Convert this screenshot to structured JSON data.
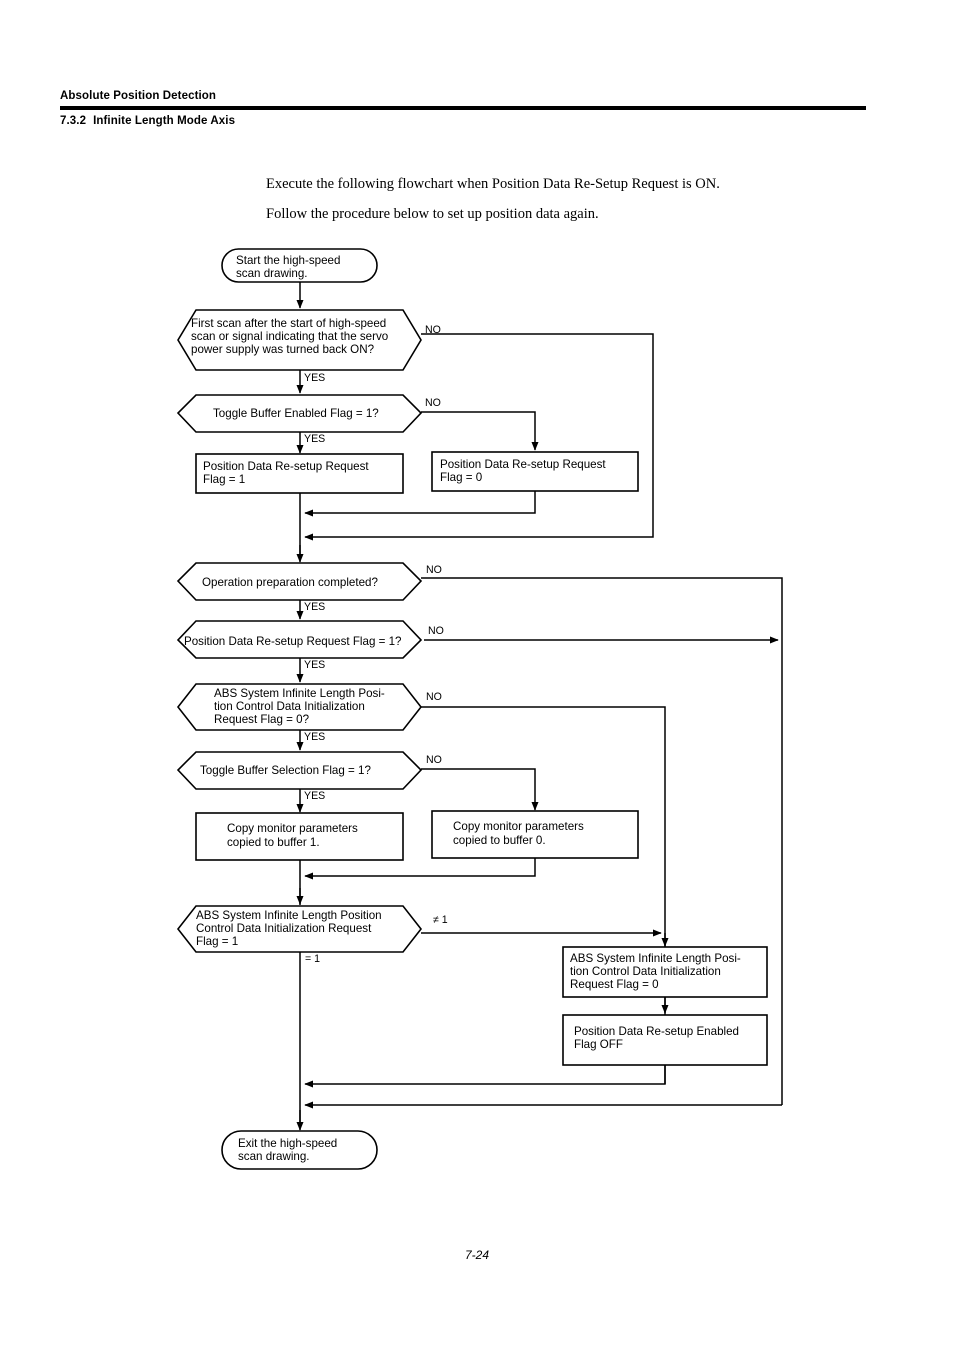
{
  "header": {
    "title": "Absolute Position Detection",
    "section_number": "7.3.2",
    "section_title": "Infinite Length Mode Axis"
  },
  "intro": {
    "line1": "Execute the following flowchart when Position Data Re-Setup Request is ON.",
    "line2": "Follow the procedure below to set up position data again."
  },
  "footer": {
    "page": "7-24"
  },
  "chart_data": {
    "type": "diagram",
    "title": "Position data re-setup flowchart (Infinite Length Mode Axis)",
    "nodes": [
      {
        "id": "start",
        "type": "terminator",
        "text": [
          "Start the high-speed",
          "scan drawing."
        ]
      },
      {
        "id": "d1",
        "type": "decision",
        "text": [
          "First scan after the start of high-speed",
          "scan or signal indicating that the servo",
          "power supply was turned back ON?"
        ]
      },
      {
        "id": "d2",
        "type": "decision",
        "text": [
          "Toggle Buffer Enabled Flag = 1?"
        ]
      },
      {
        "id": "p1",
        "type": "process",
        "text": [
          "Position Data Re-setup Request",
          "Flag = 1"
        ]
      },
      {
        "id": "p2",
        "type": "process",
        "text": [
          "Position Data Re-setup Request",
          "Flag = 0"
        ]
      },
      {
        "id": "d3",
        "type": "decision",
        "text": [
          "Operation preparation completed?"
        ]
      },
      {
        "id": "d4",
        "type": "decision",
        "text": [
          "Position Data Re-setup Request Flag = 1?"
        ]
      },
      {
        "id": "d5",
        "type": "decision",
        "text": [
          "ABS System Infinite Length Posi-",
          "tion Control Data Initialization",
          "Request Flag = 0?"
        ]
      },
      {
        "id": "d6",
        "type": "decision",
        "text": [
          "Toggle Buffer Selection Flag = 1?"
        ]
      },
      {
        "id": "p3",
        "type": "process",
        "text": [
          "Copy monitor parameters",
          "copied to buffer 1."
        ]
      },
      {
        "id": "p4",
        "type": "process",
        "text": [
          "Copy monitor parameters",
          "copied to buffer 0."
        ]
      },
      {
        "id": "d7",
        "type": "decision",
        "text": [
          "ABS System Infinite Length Position",
          "Control Data Initialization Request",
          "Flag = 1"
        ]
      },
      {
        "id": "p5",
        "type": "process",
        "text": [
          "ABS System Infinite Length Posi-",
          "tion Control Data Initialization",
          "Request Flag = 0"
        ]
      },
      {
        "id": "p6",
        "type": "process",
        "text": [
          "Position Data Re-setup Enabled",
          "Flag OFF"
        ]
      },
      {
        "id": "end",
        "type": "terminator",
        "text": [
          "Exit the high-speed",
          "scan drawing."
        ]
      }
    ],
    "edge_labels": {
      "d1_no": "NO",
      "d1_yes": "YES",
      "d2_no": "NO",
      "d2_yes": "YES",
      "d3_no": "NO",
      "d3_yes": "YES",
      "d4_no": "NO",
      "d4_yes": "YES",
      "d5_no": "NO",
      "d5_yes": "YES",
      "d6_no": "NO",
      "d6_yes": "YES",
      "d7_ne": "≠ 1",
      "d7_eq": "= 1"
    }
  }
}
